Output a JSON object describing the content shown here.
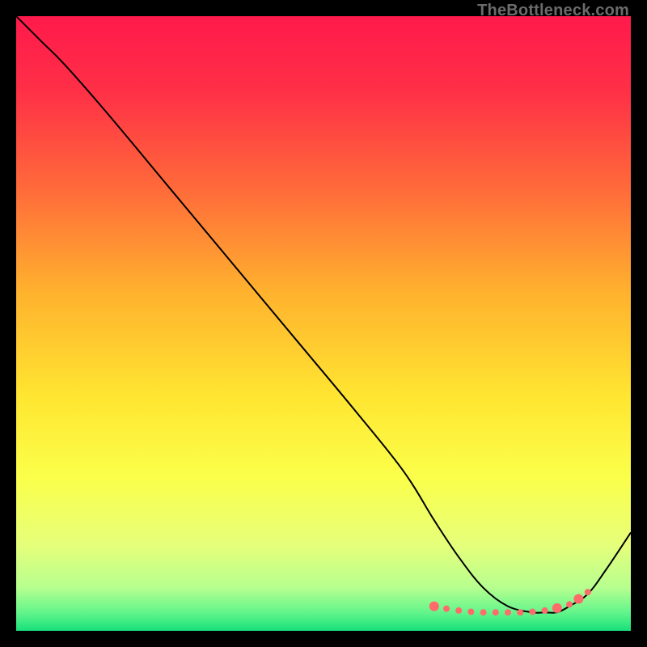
{
  "watermark": "TheBottleneck.com",
  "chart_data": {
    "type": "line",
    "title": "",
    "xlabel": "",
    "ylabel": "",
    "xlim": [
      0,
      100
    ],
    "ylim": [
      0,
      100
    ],
    "gradient_stops": [
      {
        "offset": 0.0,
        "color": "#ff1a4b"
      },
      {
        "offset": 0.12,
        "color": "#ff2f47"
      },
      {
        "offset": 0.28,
        "color": "#ff6a3a"
      },
      {
        "offset": 0.45,
        "color": "#ffb22e"
      },
      {
        "offset": 0.62,
        "color": "#ffe631"
      },
      {
        "offset": 0.75,
        "color": "#fbff4a"
      },
      {
        "offset": 0.86,
        "color": "#e6ff7a"
      },
      {
        "offset": 0.93,
        "color": "#b6ff8f"
      },
      {
        "offset": 0.97,
        "color": "#63f58b"
      },
      {
        "offset": 1.0,
        "color": "#18e07a"
      }
    ],
    "series": [
      {
        "name": "bottleneck-curve",
        "color": "#000000",
        "x": [
          0,
          4,
          8,
          15,
          25,
          35,
          45,
          55,
          63,
          68,
          72,
          76,
          80,
          84,
          86,
          88,
          90,
          93,
          96,
          100
        ],
        "y": [
          100,
          96,
          92,
          84,
          72,
          60,
          48,
          36,
          26,
          18,
          12,
          7,
          4,
          3,
          3,
          3,
          4,
          6,
          10,
          16
        ]
      }
    ],
    "markers": {
      "name": "bottom-dots",
      "color": "#ff6b6b",
      "radius_small": 4,
      "radius_large": 6,
      "points": [
        {
          "x": 68,
          "y": 4.0,
          "r": 6
        },
        {
          "x": 70,
          "y": 3.6,
          "r": 4
        },
        {
          "x": 72,
          "y": 3.3,
          "r": 4
        },
        {
          "x": 74,
          "y": 3.1,
          "r": 4
        },
        {
          "x": 76,
          "y": 3.0,
          "r": 4
        },
        {
          "x": 78,
          "y": 3.0,
          "r": 4
        },
        {
          "x": 80,
          "y": 3.0,
          "r": 4
        },
        {
          "x": 82,
          "y": 3.0,
          "r": 4
        },
        {
          "x": 84,
          "y": 3.1,
          "r": 4
        },
        {
          "x": 86,
          "y": 3.3,
          "r": 4
        },
        {
          "x": 88,
          "y": 3.7,
          "r": 6
        },
        {
          "x": 90,
          "y": 4.3,
          "r": 4
        },
        {
          "x": 91.5,
          "y": 5.2,
          "r": 6
        },
        {
          "x": 93,
          "y": 6.3,
          "r": 4
        }
      ]
    }
  }
}
